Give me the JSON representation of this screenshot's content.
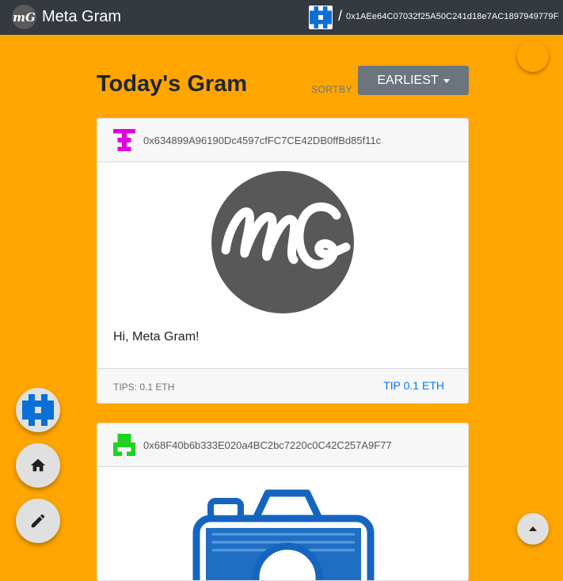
{
  "topbar": {
    "logo_text": "mG",
    "app_title": "Meta Gram",
    "separator": "/",
    "account_address": "0x1AEe64C07032f25A50C241d18e7AC1897949779F"
  },
  "page": {
    "title": "Today's Gram",
    "sort_label": "SORTBY",
    "sort_value": "EARLIEST"
  },
  "posts": [
    {
      "author": "0x634899A96190Dc4597cfFC7CE42DB0ffBd85f11c",
      "identicon_color": "#e100e1",
      "image_text": "mG",
      "caption": "Hi, Meta Gram!",
      "tips_label": "TIPS: 0.1 ETH",
      "tip_button_label": "TIP 0.1 ETH"
    },
    {
      "author": "0x68F40b6b333E020a4BC2bc7220c0C42C257A9F77",
      "identicon_color": "#1fd21f",
      "image": "camera-sketch"
    }
  ],
  "colors": {
    "background": "#ffa500",
    "topbar": "#343a40",
    "account_identicon": "#0a6fd6",
    "link": "#007bff"
  },
  "icons": {
    "fab_avatar": "identicon-avatar",
    "fab_home": "home-icon",
    "fab_edit": "pencil-icon",
    "fab_up": "scroll-up-icon"
  }
}
